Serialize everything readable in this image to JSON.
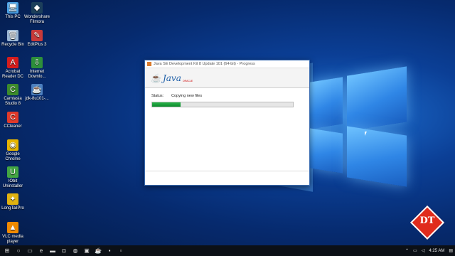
{
  "desktop": {
    "icons": [
      {
        "label": "This PC",
        "icon": "computer-icon",
        "color": "#4aa3e8"
      },
      {
        "label": "Wondershare Filmora",
        "icon": "filmora-icon",
        "color": "#1c3f5b"
      },
      {
        "label": "Recycle Bin",
        "icon": "recycle-bin-icon",
        "color": "#9bb7d4"
      },
      {
        "label": "EditPlus 3",
        "icon": "editplus-icon",
        "color": "#c83a3a"
      },
      {
        "label": "Acrobat Reader DC",
        "icon": "acrobat-icon",
        "color": "#d51d1d"
      },
      {
        "label": "Internet Downlo...",
        "icon": "idm-icon",
        "color": "#2d8f3a"
      },
      {
        "label": "Camtasia Studio 8",
        "icon": "camtasia-icon",
        "color": "#3c8b2c"
      },
      {
        "label": "jdk-8u101-...",
        "icon": "installer-icon",
        "color": "#4c7fbf"
      },
      {
        "label": "CCleaner",
        "icon": "ccleaner-icon",
        "color": "#e03a2a"
      },
      {
        "label": "Google Chrome",
        "icon": "chrome-icon",
        "color": "#e6b400"
      },
      {
        "label": "IObit Uninstaller",
        "icon": "iobit-icon",
        "color": "#43a543"
      },
      {
        "label": "LongTailPro",
        "icon": "longtailpro-icon",
        "color": "#e0b210"
      },
      {
        "label": "VLC media player",
        "icon": "vlc-icon",
        "color": "#f08a00"
      }
    ]
  },
  "installer": {
    "title": "Java SE Development Kit 8 Update 101 (64-bit) - Progress",
    "logo_text": "Java",
    "logo_sub": "ORACLE",
    "status_label": "Status:",
    "status_value": "Copying new files",
    "progress_fraction": 0.2,
    "progress_color": "#1a9e3a"
  },
  "taskbar": {
    "buttons": [
      {
        "icon": "windows-start-icon"
      },
      {
        "icon": "search-icon"
      },
      {
        "icon": "task-view-icon"
      },
      {
        "icon": "edge-icon"
      },
      {
        "icon": "file-explorer-icon"
      },
      {
        "icon": "store-icon"
      },
      {
        "icon": "media-icon"
      },
      {
        "icon": "camtasia-taskbar-icon"
      },
      {
        "icon": "java-installer-taskbar-icon"
      },
      {
        "icon": "app-taskbar-icon"
      },
      {
        "icon": "app2-taskbar-icon"
      }
    ],
    "clock": "4:25 AM"
  },
  "watermark": {
    "text": "DT",
    "color": "#e02b1c"
  }
}
